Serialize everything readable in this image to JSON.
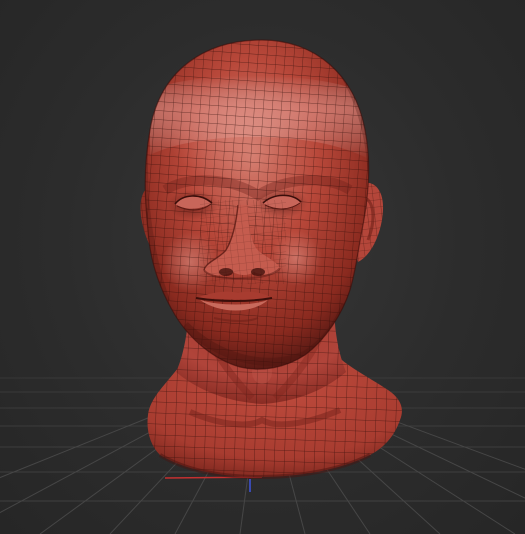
{
  "viewport": {
    "background_color": "#2b2b2b",
    "grid_color": "#4a4a4a",
    "model": {
      "subject": "human head bust",
      "material_color": "#b8483a",
      "highlight_color": "#d9837a",
      "shadow_color": "#5a1a14",
      "wire_color": "#2a0a06",
      "wireframe": true
    },
    "axes": {
      "x_color": "#c43030",
      "z_color": "#3a4ab0"
    }
  }
}
